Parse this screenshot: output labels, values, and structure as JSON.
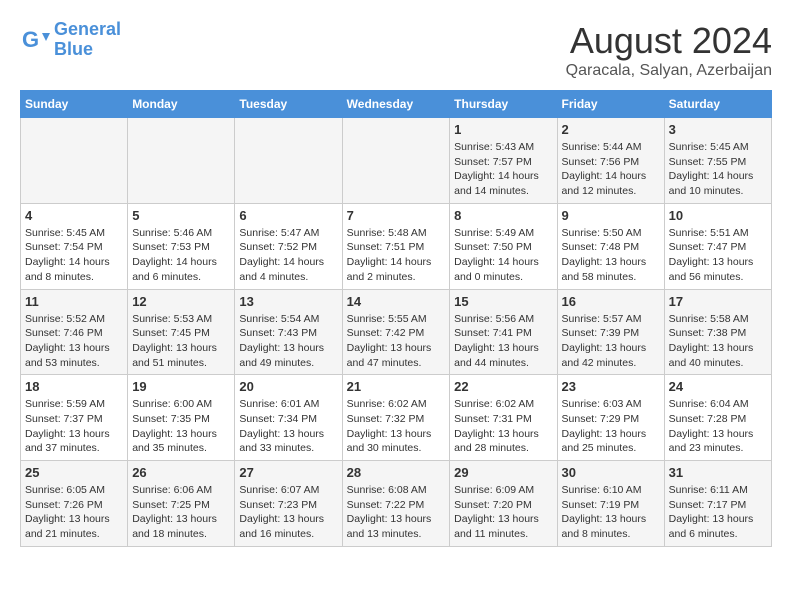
{
  "header": {
    "logo_line1": "General",
    "logo_line2": "Blue",
    "month_year": "August 2024",
    "location": "Qaracala, Salyan, Azerbaijan"
  },
  "weekdays": [
    "Sunday",
    "Monday",
    "Tuesday",
    "Wednesday",
    "Thursday",
    "Friday",
    "Saturday"
  ],
  "weeks": [
    [
      {
        "day": "",
        "info": ""
      },
      {
        "day": "",
        "info": ""
      },
      {
        "day": "",
        "info": ""
      },
      {
        "day": "",
        "info": ""
      },
      {
        "day": "1",
        "info": "Sunrise: 5:43 AM\nSunset: 7:57 PM\nDaylight: 14 hours\nand 14 minutes."
      },
      {
        "day": "2",
        "info": "Sunrise: 5:44 AM\nSunset: 7:56 PM\nDaylight: 14 hours\nand 12 minutes."
      },
      {
        "day": "3",
        "info": "Sunrise: 5:45 AM\nSunset: 7:55 PM\nDaylight: 14 hours\nand 10 minutes."
      }
    ],
    [
      {
        "day": "4",
        "info": "Sunrise: 5:45 AM\nSunset: 7:54 PM\nDaylight: 14 hours\nand 8 minutes."
      },
      {
        "day": "5",
        "info": "Sunrise: 5:46 AM\nSunset: 7:53 PM\nDaylight: 14 hours\nand 6 minutes."
      },
      {
        "day": "6",
        "info": "Sunrise: 5:47 AM\nSunset: 7:52 PM\nDaylight: 14 hours\nand 4 minutes."
      },
      {
        "day": "7",
        "info": "Sunrise: 5:48 AM\nSunset: 7:51 PM\nDaylight: 14 hours\nand 2 minutes."
      },
      {
        "day": "8",
        "info": "Sunrise: 5:49 AM\nSunset: 7:50 PM\nDaylight: 14 hours\nand 0 minutes."
      },
      {
        "day": "9",
        "info": "Sunrise: 5:50 AM\nSunset: 7:48 PM\nDaylight: 13 hours\nand 58 minutes."
      },
      {
        "day": "10",
        "info": "Sunrise: 5:51 AM\nSunset: 7:47 PM\nDaylight: 13 hours\nand 56 minutes."
      }
    ],
    [
      {
        "day": "11",
        "info": "Sunrise: 5:52 AM\nSunset: 7:46 PM\nDaylight: 13 hours\nand 53 minutes."
      },
      {
        "day": "12",
        "info": "Sunrise: 5:53 AM\nSunset: 7:45 PM\nDaylight: 13 hours\nand 51 minutes."
      },
      {
        "day": "13",
        "info": "Sunrise: 5:54 AM\nSunset: 7:43 PM\nDaylight: 13 hours\nand 49 minutes."
      },
      {
        "day": "14",
        "info": "Sunrise: 5:55 AM\nSunset: 7:42 PM\nDaylight: 13 hours\nand 47 minutes."
      },
      {
        "day": "15",
        "info": "Sunrise: 5:56 AM\nSunset: 7:41 PM\nDaylight: 13 hours\nand 44 minutes."
      },
      {
        "day": "16",
        "info": "Sunrise: 5:57 AM\nSunset: 7:39 PM\nDaylight: 13 hours\nand 42 minutes."
      },
      {
        "day": "17",
        "info": "Sunrise: 5:58 AM\nSunset: 7:38 PM\nDaylight: 13 hours\nand 40 minutes."
      }
    ],
    [
      {
        "day": "18",
        "info": "Sunrise: 5:59 AM\nSunset: 7:37 PM\nDaylight: 13 hours\nand 37 minutes."
      },
      {
        "day": "19",
        "info": "Sunrise: 6:00 AM\nSunset: 7:35 PM\nDaylight: 13 hours\nand 35 minutes."
      },
      {
        "day": "20",
        "info": "Sunrise: 6:01 AM\nSunset: 7:34 PM\nDaylight: 13 hours\nand 33 minutes."
      },
      {
        "day": "21",
        "info": "Sunrise: 6:02 AM\nSunset: 7:32 PM\nDaylight: 13 hours\nand 30 minutes."
      },
      {
        "day": "22",
        "info": "Sunrise: 6:02 AM\nSunset: 7:31 PM\nDaylight: 13 hours\nand 28 minutes."
      },
      {
        "day": "23",
        "info": "Sunrise: 6:03 AM\nSunset: 7:29 PM\nDaylight: 13 hours\nand 25 minutes."
      },
      {
        "day": "24",
        "info": "Sunrise: 6:04 AM\nSunset: 7:28 PM\nDaylight: 13 hours\nand 23 minutes."
      }
    ],
    [
      {
        "day": "25",
        "info": "Sunrise: 6:05 AM\nSunset: 7:26 PM\nDaylight: 13 hours\nand 21 minutes."
      },
      {
        "day": "26",
        "info": "Sunrise: 6:06 AM\nSunset: 7:25 PM\nDaylight: 13 hours\nand 18 minutes."
      },
      {
        "day": "27",
        "info": "Sunrise: 6:07 AM\nSunset: 7:23 PM\nDaylight: 13 hours\nand 16 minutes."
      },
      {
        "day": "28",
        "info": "Sunrise: 6:08 AM\nSunset: 7:22 PM\nDaylight: 13 hours\nand 13 minutes."
      },
      {
        "day": "29",
        "info": "Sunrise: 6:09 AM\nSunset: 7:20 PM\nDaylight: 13 hours\nand 11 minutes."
      },
      {
        "day": "30",
        "info": "Sunrise: 6:10 AM\nSunset: 7:19 PM\nDaylight: 13 hours\nand 8 minutes."
      },
      {
        "day": "31",
        "info": "Sunrise: 6:11 AM\nSunset: 7:17 PM\nDaylight: 13 hours\nand 6 minutes."
      }
    ]
  ]
}
